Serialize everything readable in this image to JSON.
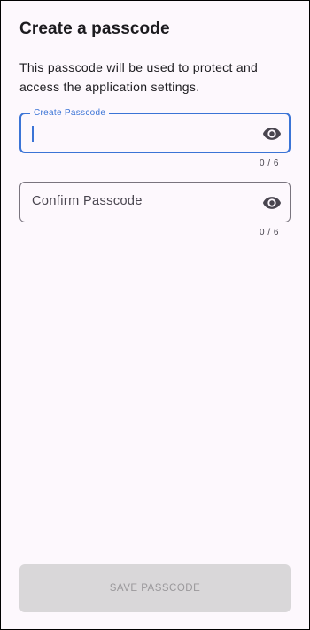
{
  "page": {
    "title": "Create a passcode",
    "description": "This passcode will be used to protect and access the application settings."
  },
  "fields": {
    "create": {
      "label": "Create Passcode",
      "value": "",
      "counter": "0 / 6",
      "state": "focused",
      "toggle_icon": "eye-icon"
    },
    "confirm": {
      "label": "Confirm Passcode",
      "value": "",
      "counter": "0 / 6",
      "state": "idle",
      "toggle_icon": "eye-icon"
    }
  },
  "actions": {
    "save_label": "SAVE PASSCODE",
    "save_enabled": false
  },
  "colors": {
    "accent": "#3b74d6",
    "background": "#fdf8fd",
    "text": "#1c1b1f",
    "outline": "#79747e",
    "disabled_button": "#d9d7d9",
    "disabled_text": "#9a989b"
  }
}
